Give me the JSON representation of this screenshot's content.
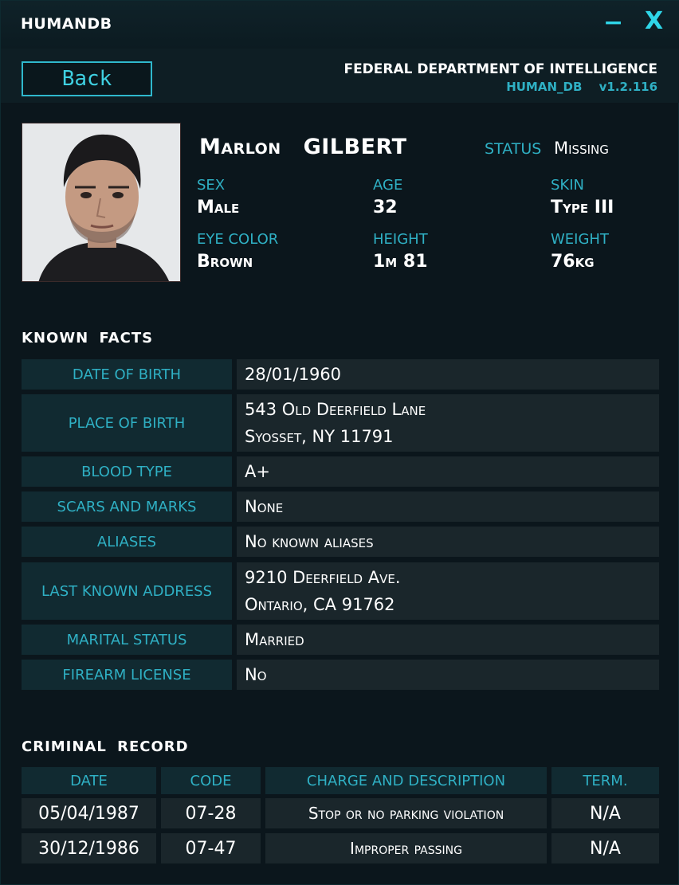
{
  "app": {
    "title": "HUMANDB",
    "minimize_glyph": "−",
    "close_glyph": "X"
  },
  "header": {
    "back_label": "Back",
    "agency": "FEDERAL DEPARTMENT OF INTELLIGENCE",
    "db_name": "HUMAN_DB",
    "version": "v1.2.116"
  },
  "profile": {
    "first_name": "Marlon",
    "last_name": "GILBERT",
    "status_label": "STATUS",
    "status_value": "Missing",
    "attributes": [
      {
        "label": "SEX",
        "value": "Male"
      },
      {
        "label": "AGE",
        "value": "32"
      },
      {
        "label": "SKIN",
        "value": "Type III"
      },
      {
        "label": "EYE COLOR",
        "value": "Brown"
      },
      {
        "label": "HEIGHT",
        "value": "1m 81"
      },
      {
        "label": "WEIGHT",
        "value": "76kg"
      }
    ]
  },
  "known_facts": {
    "title": "KNOWN FACTS",
    "rows": [
      {
        "label": "DATE OF BIRTH",
        "lines": [
          "28/01/1960"
        ]
      },
      {
        "label": "PLACE OF BIRTH",
        "lines": [
          "543 Old Deerfield Lane",
          "Syosset, NY 11791"
        ]
      },
      {
        "label": "BLOOD TYPE",
        "lines": [
          "A+"
        ]
      },
      {
        "label": "SCARS AND MARKS",
        "lines": [
          "None"
        ]
      },
      {
        "label": "ALIASES",
        "lines": [
          "No known aliases"
        ]
      },
      {
        "label": "LAST KNOWN ADDRESS",
        "lines": [
          "9210 Deerfield Ave.",
          "Ontario, CA 91762"
        ]
      },
      {
        "label": "MARITAL STATUS",
        "lines": [
          "Married"
        ]
      },
      {
        "label": "FIREARM LICENSE",
        "lines": [
          "No"
        ]
      }
    ]
  },
  "criminal_record": {
    "title": "CRIMINAL RECORD",
    "columns": [
      "DATE",
      "CODE",
      "CHARGE AND DESCRIPTION",
      "TERM."
    ],
    "rows": [
      [
        "05/04/1987",
        "07-28",
        "Stop or no parking violation",
        "N/A"
      ],
      [
        "30/12/1986",
        "07-47",
        "Improper passing",
        "N/A"
      ]
    ]
  },
  "colors": {
    "accent": "#2fb0c4",
    "background": "#0b161c",
    "label_cell": "#112a31",
    "value_cell": "#1a262b"
  }
}
